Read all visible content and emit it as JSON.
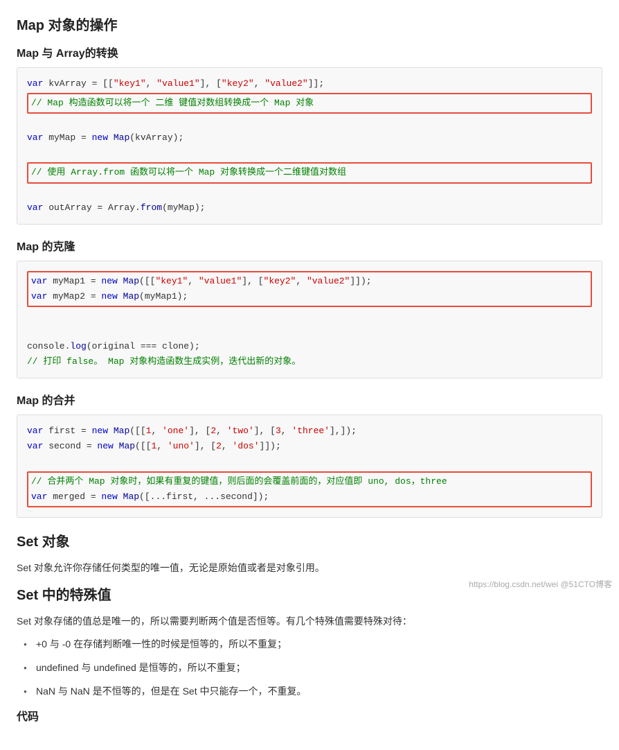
{
  "page": {
    "main_title": "Map 对象的操作",
    "sections": [
      {
        "id": "map-array-convert",
        "heading": "Map 与 Array的转换",
        "code_blocks": [
          {
            "id": "code1",
            "lines": [
              {
                "text": "var kvArray = [[\"key1\", \"value1\"], [\"key2\", \"value2\"]];",
                "highlight": false
              },
              {
                "text": "// Map 构造函数可以将一个 二维 键值对数组转换成一个 Map 对象",
                "highlight": true,
                "comment": true
              },
              {
                "text": "var myMap = new Map(kvArray);",
                "highlight": false
              },
              {
                "text": "",
                "highlight": false
              },
              {
                "text": "// 使用 Array.from 函数可以将一个 Map 对象转换成一个二维键值对数组",
                "highlight": true,
                "comment": true
              },
              {
                "text": "var outArray = Array.from(myMap);",
                "highlight": false
              }
            ]
          }
        ]
      },
      {
        "id": "map-clone",
        "heading": "Map 的克隆",
        "code_blocks": [
          {
            "id": "code2",
            "lines": [
              {
                "text": "var myMap1 = new Map([[\"key1\", \"value1\"], [\"key2\", \"value2\"]]);",
                "highlight": true
              },
              {
                "text": "var myMap2 = new Map(myMap1);",
                "highlight": true
              },
              {
                "text": "",
                "highlight": false
              },
              {
                "text": "console.log(original === clone);",
                "highlight": false
              },
              {
                "text": "// 打印 false。 Map 对象构造函数生成实例，迭代出新的对象。",
                "highlight": false,
                "comment": true
              }
            ]
          }
        ]
      },
      {
        "id": "map-merge",
        "heading": "Map 的合并",
        "code_blocks": [
          {
            "id": "code3",
            "lines": [
              {
                "text": "var first = new Map([[1, 'one'], [2, 'two'], [3, 'three'],]);",
                "highlight": false
              },
              {
                "text": "var second = new Map([[1, 'uno'], [2, 'dos']]);",
                "highlight": false
              },
              {
                "text": "",
                "highlight": false
              },
              {
                "text": "// 合并两个 Map 对象时，如果有重复的键值，则后面的会覆盖前面的，对应值即 uno, dos，three",
                "highlight": true,
                "comment": true
              },
              {
                "text": "var merged = new Map([...first, ...second]);",
                "highlight": true
              }
            ]
          }
        ]
      }
    ],
    "set_section": {
      "title": "Set 对象",
      "intro": "Set 对象允许你存储任何类型的唯一值，无论是原始值或者是对象引用。",
      "special_values_title": "Set 中的特殊值",
      "special_values_intro": "Set 对象存储的值总是唯一的，所以需要判断两个值是否恒等。有几个特殊值需要特殊对待：",
      "special_values_list": [
        "+0 与 -0 在存储判断唯一性的时候是恒等的，所以不重复；",
        "undefined 与 undefined 是恒等的，所以不重复；",
        "NaN 与 NaN 是不恒等的，但是在 Set 中只能存一个，不重复。"
      ],
      "code_label": "代码"
    },
    "watermark": "https://blog.csdn.net/wei @51CTO博客"
  }
}
